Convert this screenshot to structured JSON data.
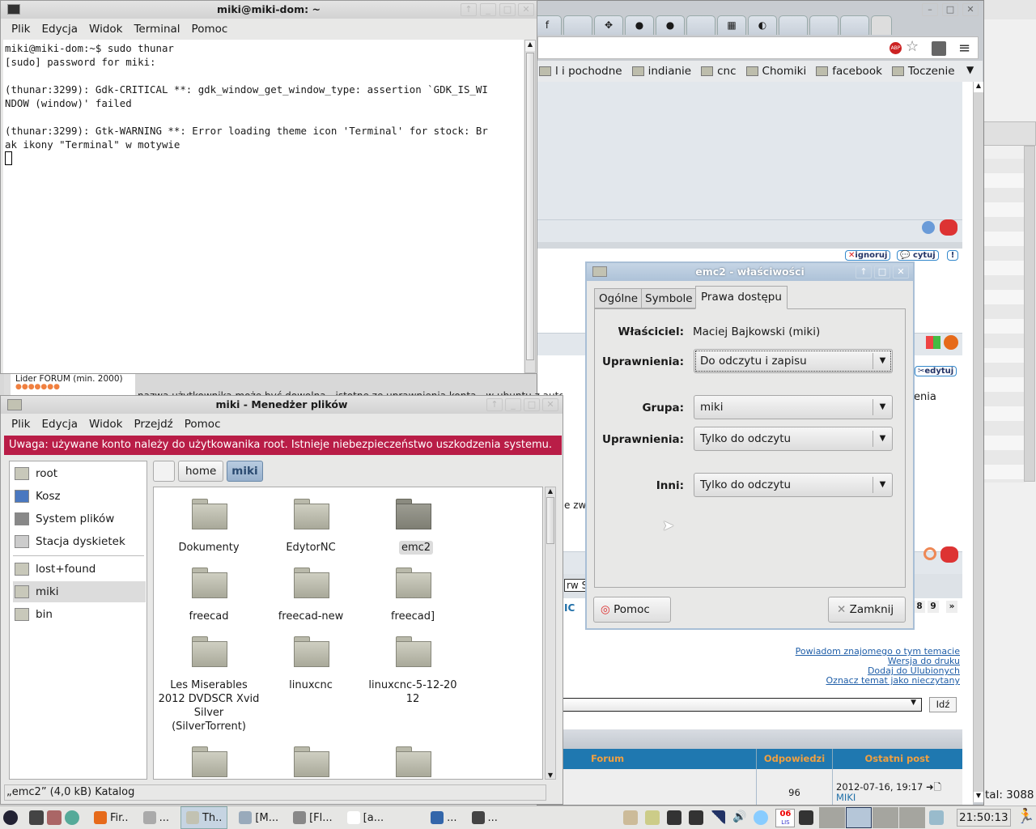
{
  "right_window": {
    "status_text": "tal: 3088"
  },
  "browser": {
    "tabs": [
      "f",
      "",
      "✥",
      "●",
      "●",
      "",
      "▦",
      "◐",
      "",
      "",
      ""
    ],
    "bookmarks": [
      "l i pochodne",
      "indianie",
      "cnc",
      "Chomiki",
      "facebook",
      "Toczenie"
    ],
    "post_rank": "Lider FORUM (min. 2000)",
    "post_text": "nazwa użytkownika może być dowolna - istotne ze uprawnienia konta - w ubuntu z automat",
    "post_text_right": "enia",
    "snippet_zw": "e zw",
    "snippet_rw": "rw St",
    "snippet_ic": "IC",
    "buttons": {
      "ignore": "ignoruj",
      "quote": "cytuj",
      "report": "!",
      "edit": "edytuj"
    },
    "pages": [
      "8",
      "9",
      "»"
    ],
    "links": [
      "Powiadom znajomego o tym temacie",
      "Wersja do druku",
      "Dodaj do Ulubionych",
      "Oznacz temat jako nieczytany"
    ],
    "go_button": "Idź",
    "table": {
      "headers": [
        "Forum",
        "Odpowiedzi",
        "Ostatni post"
      ],
      "rows": [
        {
          "replies": "96",
          "last_post": "2012-07-16, 19:17",
          "author": "MIKI"
        }
      ]
    },
    "header_color": "#1f78b0",
    "header_text_color": "#f0a040"
  },
  "terminal": {
    "title": "miki@miki-dom: ~",
    "menu": [
      "Plik",
      "Edycja",
      "Widok",
      "Terminal",
      "Pomoc"
    ],
    "lines": [
      "miki@miki-dom:~$ sudo thunar",
      "[sudo] password for miki:",
      "",
      "(thunar:3299): Gdk-CRITICAL **: gdk_window_get_window_type: assertion `GDK_IS_WI",
      "NDOW (window)' failed",
      "",
      "(thunar:3299): Gtk-WARNING **: Error loading theme icon 'Terminal' for stock: Br",
      "ak ikony \"Terminal\" w motywie"
    ]
  },
  "filemanager": {
    "title": "miki - Menedżer plików",
    "menu": [
      "Plik",
      "Edycja",
      "Widok",
      "Przejdź",
      "Pomoc"
    ],
    "warning": "Uwaga: używane konto należy do użytkowanika root. Istnieje niebezpieczeństwo uszkodzenia systemu.",
    "warning_color": "#b91d47",
    "sidebar": [
      "root",
      "Kosz",
      "System plików",
      "Stacja dyskietek",
      "lost+found",
      "miki",
      "bin"
    ],
    "path": [
      "home",
      "miki"
    ],
    "files": [
      "Dokumenty",
      "EdytorNC",
      "emc2",
      "freecad",
      "freecad-new",
      "freecad]",
      "Les Miserables 2012 DVDSCR Xvid Silver (SilverTorrent)",
      "linuxcnc",
      "linuxcnc-5-12-20 12",
      "",
      "",
      ""
    ],
    "selected_file": "emc2",
    "status": "„emc2” (4,0 kB) Katalog"
  },
  "dialog": {
    "title": "emc2 - właściwości",
    "tabs": [
      "Ogólne",
      "Symbole",
      "Prawa dostępu"
    ],
    "active_tab": "Prawa dostępu",
    "owner_label": "Właściciel:",
    "owner": "Maciej Bajkowski (miki)",
    "perm_label": "Uprawnienia:",
    "owner_perm": "Do odczytu i zapisu",
    "group_label": "Grupa:",
    "group": "miki",
    "group_perm": "Tylko do odczytu",
    "others_label": "Inni:",
    "others_perm": "Tylko do odczytu",
    "help_button": "Pomoc",
    "close_button": "Zamknij"
  },
  "taskbar": {
    "tasks": [
      "Fir..",
      "...",
      "Th..",
      "[M...",
      "[Fl...",
      "[a...",
      "...",
      "..."
    ],
    "active_task": "Th..",
    "calendar_day": "06",
    "calendar_month": "LIS",
    "clock": "21:50:13"
  }
}
